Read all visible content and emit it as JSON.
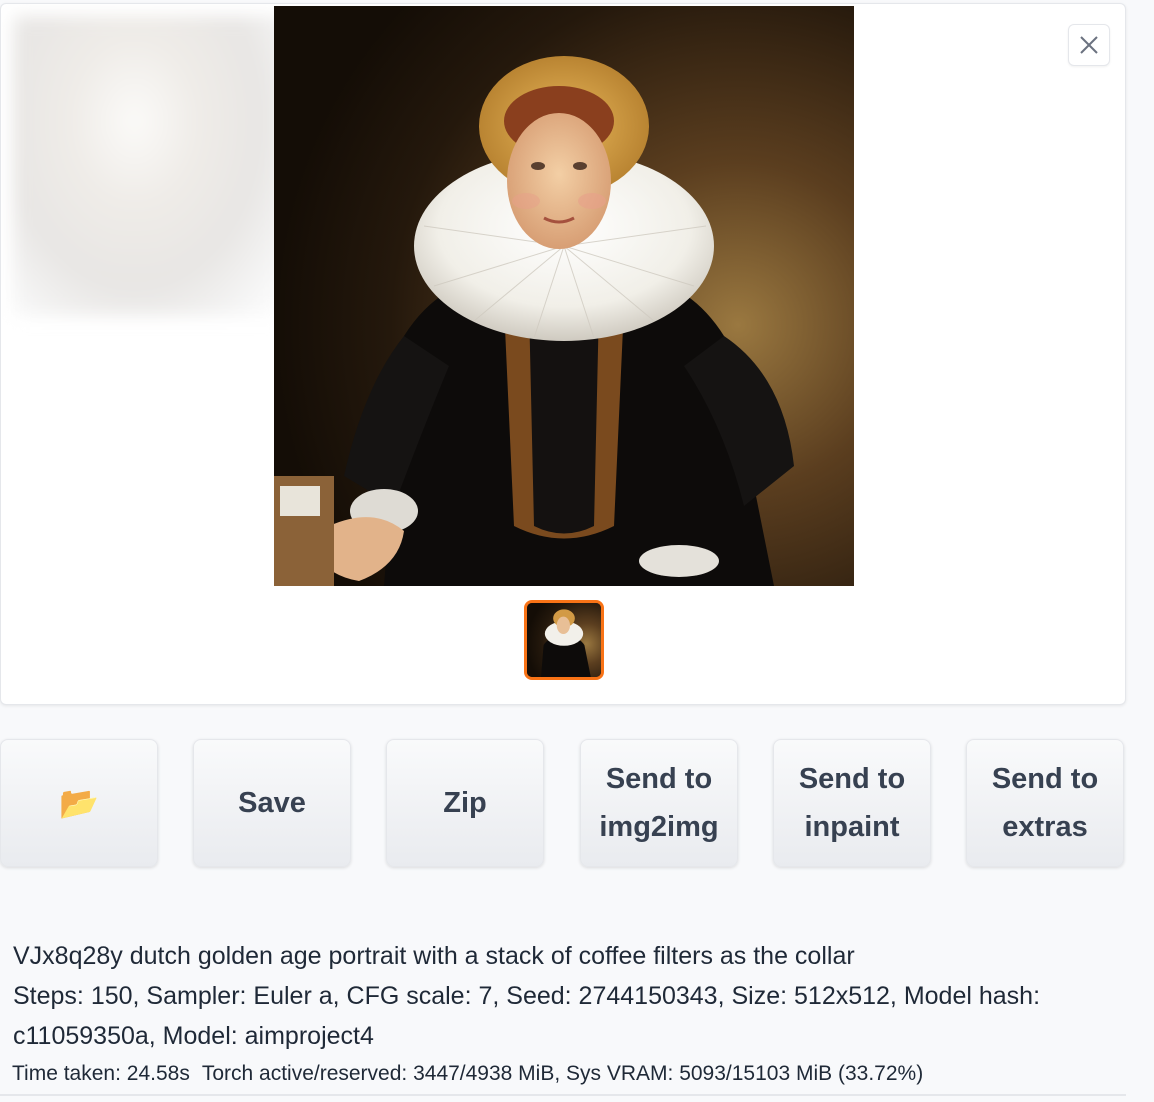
{
  "gallery": {
    "close_icon": "close-icon",
    "accent_color": "#f97316"
  },
  "buttons": {
    "open_folder_icon": "folder-icon",
    "open_folder_glyph": "📂",
    "save_label": "Save",
    "zip_label": "Zip",
    "send_img2img_label": "Send to\nimg2img",
    "send_inpaint_label": "Send to\ninpaint",
    "send_extras_label": "Send to\nextras"
  },
  "generation_info": {
    "prompt": "VJx8q28y dutch golden age portrait with a stack of coffee filters as the collar",
    "parameters": "Steps: 150, Sampler: Euler a, CFG scale: 7, Seed: 2744150343, Size: 512x512, Model hash: c11059350a, Model: aimproject4"
  },
  "timing": {
    "time_taken": "Time taken: 24.58s",
    "memory": "Torch active/reserved: 3447/4938 MiB, Sys VRAM: 5093/15103 MiB (33.72%)"
  }
}
